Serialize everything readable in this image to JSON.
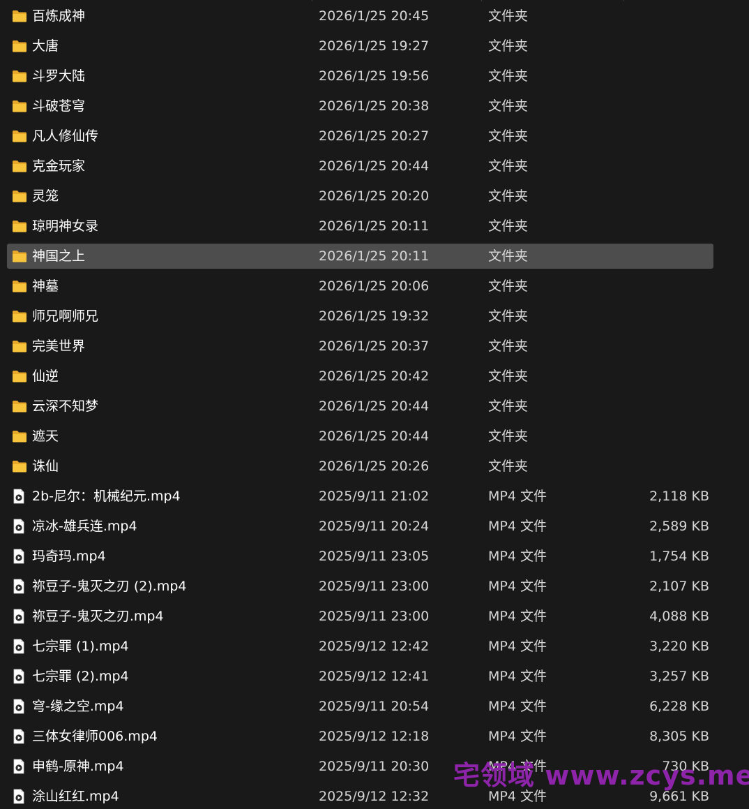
{
  "files": [
    {
      "kind": "folder",
      "name": "百炼成神",
      "modified": "2026/1/25 20:45",
      "type": "文件夹",
      "size": ""
    },
    {
      "kind": "folder",
      "name": "大唐",
      "modified": "2026/1/25 19:27",
      "type": "文件夹",
      "size": ""
    },
    {
      "kind": "folder",
      "name": "斗罗大陆",
      "modified": "2026/1/25 19:56",
      "type": "文件夹",
      "size": ""
    },
    {
      "kind": "folder",
      "name": "斗破苍穹",
      "modified": "2026/1/25 20:38",
      "type": "文件夹",
      "size": ""
    },
    {
      "kind": "folder",
      "name": "凡人修仙传",
      "modified": "2026/1/25 20:27",
      "type": "文件夹",
      "size": ""
    },
    {
      "kind": "folder",
      "name": "克金玩家",
      "modified": "2026/1/25 20:44",
      "type": "文件夹",
      "size": ""
    },
    {
      "kind": "folder",
      "name": "灵笼",
      "modified": "2026/1/25 20:20",
      "type": "文件夹",
      "size": ""
    },
    {
      "kind": "folder",
      "name": "琼明神女录",
      "modified": "2026/1/25 20:11",
      "type": "文件夹",
      "size": ""
    },
    {
      "kind": "folder",
      "name": "神国之上",
      "modified": "2026/1/25 20:11",
      "type": "文件夹",
      "size": "",
      "selected": true
    },
    {
      "kind": "folder",
      "name": "神墓",
      "modified": "2026/1/25 20:06",
      "type": "文件夹",
      "size": ""
    },
    {
      "kind": "folder",
      "name": "师兄啊师兄",
      "modified": "2026/1/25 19:32",
      "type": "文件夹",
      "size": ""
    },
    {
      "kind": "folder",
      "name": "完美世界",
      "modified": "2026/1/25 20:37",
      "type": "文件夹",
      "size": ""
    },
    {
      "kind": "folder",
      "name": "仙逆",
      "modified": "2026/1/25 20:42",
      "type": "文件夹",
      "size": ""
    },
    {
      "kind": "folder",
      "name": "云深不知梦",
      "modified": "2026/1/25 20:44",
      "type": "文件夹",
      "size": ""
    },
    {
      "kind": "folder",
      "name": "遮天",
      "modified": "2026/1/25 20:44",
      "type": "文件夹",
      "size": ""
    },
    {
      "kind": "folder",
      "name": "诛仙",
      "modified": "2026/1/25 20:26",
      "type": "文件夹",
      "size": ""
    },
    {
      "kind": "video",
      "name": "2b-尼尔：机械纪元.mp4",
      "modified": "2025/9/11 21:02",
      "type": "MP4 文件",
      "size": "2,118 KB"
    },
    {
      "kind": "video",
      "name": "凉冰-雄兵连.mp4",
      "modified": "2025/9/11 20:24",
      "type": "MP4 文件",
      "size": "2,589 KB"
    },
    {
      "kind": "video",
      "name": "玛奇玛.mp4",
      "modified": "2025/9/11 23:05",
      "type": "MP4 文件",
      "size": "1,754 KB"
    },
    {
      "kind": "video",
      "name": "祢豆子-鬼灭之刃 (2).mp4",
      "modified": "2025/9/11 23:00",
      "type": "MP4 文件",
      "size": "2,107 KB"
    },
    {
      "kind": "video",
      "name": "祢豆子-鬼灭之刃.mp4",
      "modified": "2025/9/11 23:00",
      "type": "MP4 文件",
      "size": "4,088 KB"
    },
    {
      "kind": "video",
      "name": "七宗罪 (1).mp4",
      "modified": "2025/9/12 12:42",
      "type": "MP4 文件",
      "size": "3,220 KB"
    },
    {
      "kind": "video",
      "name": "七宗罪 (2).mp4",
      "modified": "2025/9/12 12:41",
      "type": "MP4 文件",
      "size": "3,257 KB"
    },
    {
      "kind": "video",
      "name": "穹-缘之空.mp4",
      "modified": "2025/9/11 20:54",
      "type": "MP4 文件",
      "size": "6,228 KB"
    },
    {
      "kind": "video",
      "name": "三体女律师006.mp4",
      "modified": "2025/9/12 12:18",
      "type": "MP4 文件",
      "size": "8,305 KB"
    },
    {
      "kind": "video",
      "name": "申鹤-原神.mp4",
      "modified": "2025/9/11 20:30",
      "type": "MP4 文件",
      "size": "730 KB"
    },
    {
      "kind": "video",
      "name": "涂山红红.mp4",
      "modified": "2025/9/12 12:32",
      "type": "MP4 文件",
      "size": "9,661 KB"
    }
  ],
  "watermark": "宅领域 www.zcys.me",
  "colors": {
    "background": "#191919",
    "selected_row": "#4d4d4d",
    "folder_yellow": "#f8c43c",
    "watermark": "#8e24aa"
  }
}
